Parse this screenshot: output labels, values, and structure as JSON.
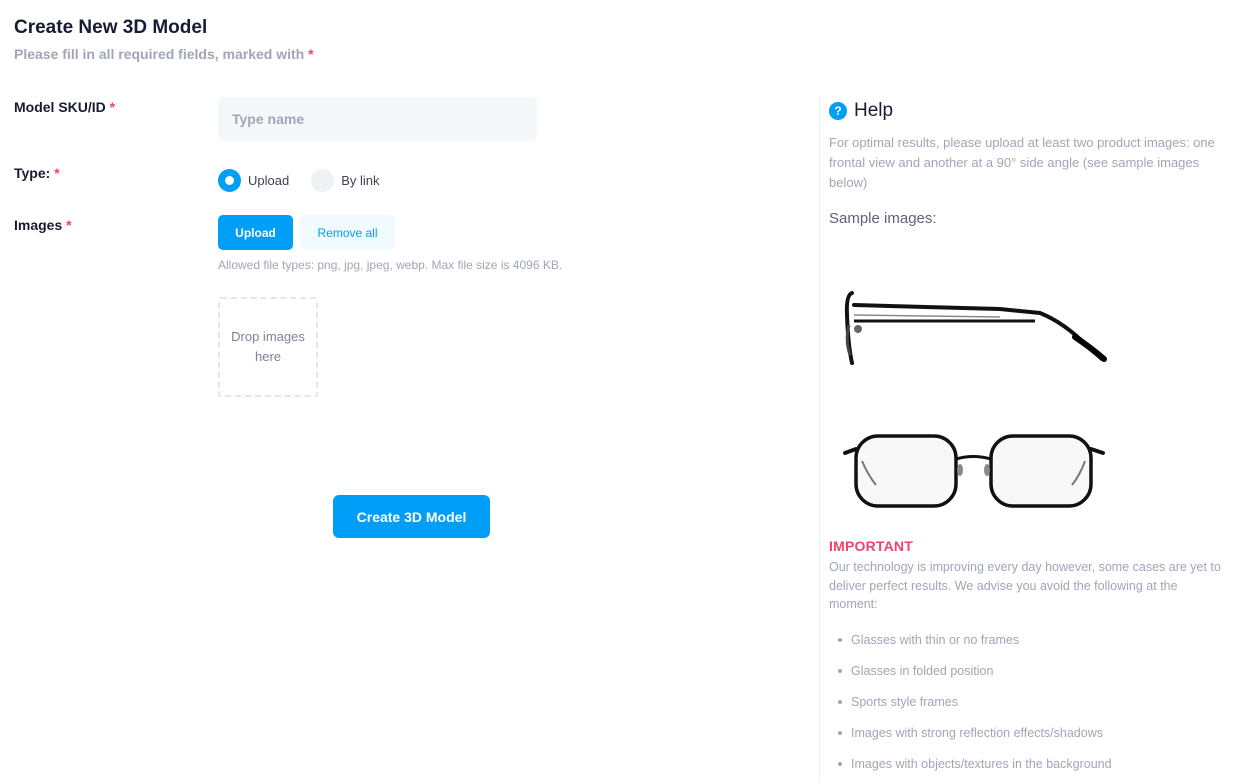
{
  "header": {
    "title": "Create New 3D Model",
    "subtitle": "Please fill in all required fields, marked with",
    "required_mark": "*"
  },
  "form": {
    "sku_label": "Model SKU/ID",
    "sku_placeholder": "Type name",
    "sku_value": "",
    "type_label": "Type:",
    "type_options": [
      {
        "label": "Upload",
        "checked": true
      },
      {
        "label": "By link",
        "checked": false
      }
    ],
    "images_label": "Images",
    "upload_button": "Upload",
    "remove_all_button": "Remove all",
    "file_hint": "Allowed file types: png, jpg, jpeg, webp. Max file size is 4096 KB.",
    "dropzone_text": "Drop images here",
    "submit_button": "Create 3D Model"
  },
  "help": {
    "icon": "question-circle-icon",
    "title": "Help",
    "description": "For optimal results, please upload at least two product images: one frontal view and another at a 90° side angle (see sample images below)",
    "sample_title": "Sample images:",
    "samples": [
      "glasses-side-view",
      "glasses-front-view"
    ],
    "important_title": "IMPORTANT",
    "important_desc": "Our technology is improving every day however, some cases are yet to deliver perfect results. We advise you avoid the following at the moment:",
    "avoid_items": [
      "Glasses with thin or no frames",
      "Glasses in folded position",
      "Sports style frames",
      "Images with strong reflection effects/shadows",
      "Images with objects/textures in the background"
    ]
  },
  "colors": {
    "primary": "#009ef7",
    "danger": "#f1416c",
    "muted": "#a1a5b7",
    "heading": "#181c32"
  }
}
